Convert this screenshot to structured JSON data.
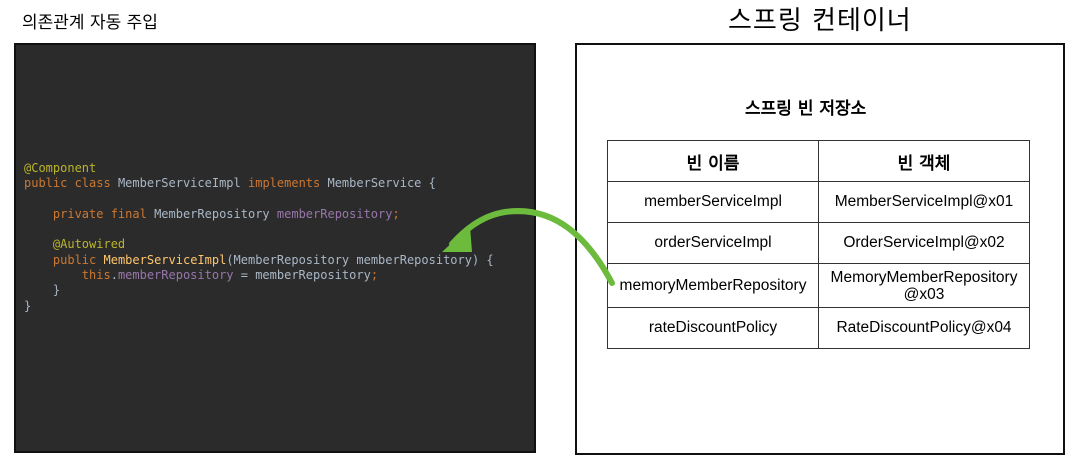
{
  "left_title": "의존관계 자동 주입",
  "right_title": "스프링 컨테이너",
  "code": {
    "line1": "@Component",
    "line2_kw": "public class",
    "line2_name": "MemberServiceImpl",
    "line2_impl": "implements",
    "line2_iface": "MemberService {",
    "line3_kw": "private final",
    "line3_type": "MemberRepository",
    "line3_field": "memberRepository",
    "line3_end": ";",
    "line4": "@Autowired",
    "line5_kw": "public",
    "line5_name": "MemberServiceImpl",
    "line5_params": "(MemberRepository memberRepository) {",
    "line6_this": "this",
    "line6_field": "memberRepository",
    "line6_rest": " = memberRepository",
    "line6_end": ";",
    "close_inner": "}",
    "close_outer": "}"
  },
  "repository": {
    "title": "스프링 빈 저장소",
    "headers": [
      "빈 이름",
      "빈 객체"
    ],
    "rows": [
      [
        "memberServiceImpl",
        "MemberServiceImpl@x01"
      ],
      [
        "orderServiceImpl",
        "OrderServiceImpl@x02"
      ],
      [
        "memoryMemberRepository",
        "MemoryMemberRepository\n@x03"
      ],
      [
        "rateDiscountPolicy",
        "RateDiscountPolicy@x04"
      ]
    ]
  },
  "colors": {
    "code_bg": "#2b2b2b",
    "code_text": "#a9b7c6",
    "annotation": "#bbb529",
    "keyword": "#cc7832",
    "field": "#9876aa",
    "method": "#ffc66d",
    "arrow": "#6dbb3c"
  }
}
